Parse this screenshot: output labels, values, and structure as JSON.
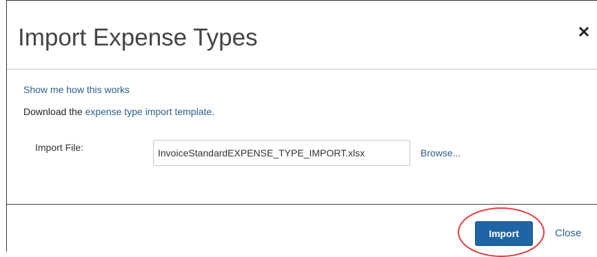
{
  "dialog": {
    "title": "Import Expense Types",
    "close_icon": "close-icon"
  },
  "body": {
    "help_link": "Show me how this works",
    "download_prefix": "Download the ",
    "download_link": "expense type import template",
    "download_suffix": ".",
    "import_file_label": "Import File:",
    "import_file_value": "InvoiceStandardEXPENSE_TYPE_IMPORT.xlsx",
    "browse_label": "Browse..."
  },
  "footer": {
    "import_label": "Import",
    "close_label": "Close"
  },
  "colors": {
    "link": "#2c5e8c",
    "primary_button": "#1f65a6",
    "highlight": "#e23a3a"
  }
}
